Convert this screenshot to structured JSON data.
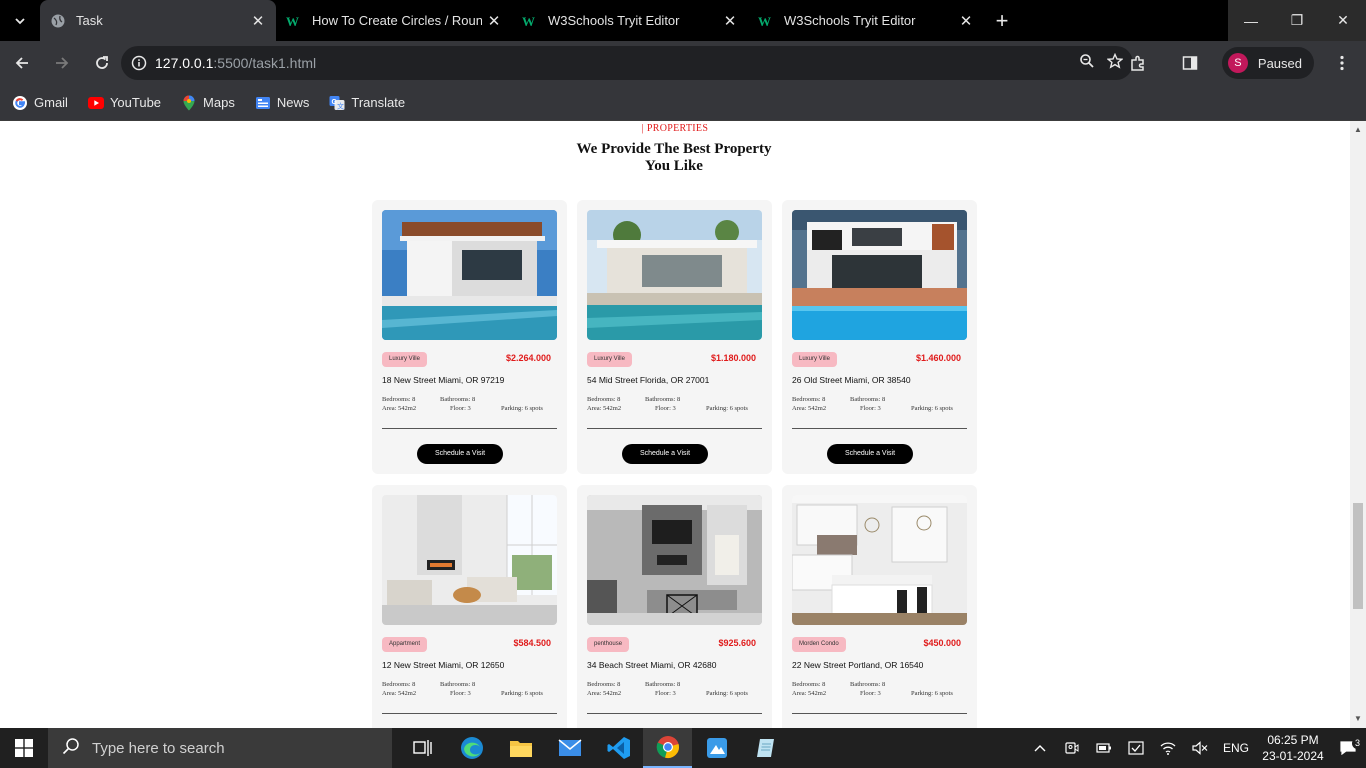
{
  "browser": {
    "tabs": [
      {
        "title": "Task",
        "active": true
      },
      {
        "title": "How To Create Circles / Round D",
        "active": false
      },
      {
        "title": "W3Schools Tryit Editor",
        "active": false
      },
      {
        "title": "W3Schools Tryit Editor",
        "active": false
      }
    ],
    "url_host": "127.0.0.1",
    "url_path": ":5500/task1.html",
    "profile_initial": "S",
    "profile_status": "Paused",
    "bookmarks": [
      "Gmail",
      "YouTube",
      "Maps",
      "News",
      "Translate"
    ]
  },
  "page": {
    "eyebrow": "| PROPERTIES",
    "heading": "We Provide The Best Property You Like",
    "schedule_label": "Schedule a Visit",
    "spec_labels": {
      "bedrooms": "Bedrooms: 8",
      "bathrooms": "Bathrooms: 8",
      "area": "Area: 542m2",
      "floor": "Floor: 3",
      "parking": "Parking: 6 spots"
    },
    "properties": [
      {
        "badge": "Luxury Ville",
        "price": "$2.264.000",
        "address": "18 New Street Miami, OR 97219"
      },
      {
        "badge": "Luxury Ville",
        "price": "$1.180.000",
        "address": "54 Mid Street Florida, OR 27001"
      },
      {
        "badge": "Luxury Ville",
        "price": "$1.460.000",
        "address": "26 Old Street Miami, OR 38540"
      },
      {
        "badge": "Appartment",
        "price": "$584.500",
        "address": "12 New Street Miami, OR 12650"
      },
      {
        "badge": "penthouse",
        "price": "$925.600",
        "address": "34 Beach Street Miami, OR 42680"
      },
      {
        "badge": "Morden Condo",
        "price": "$450.000",
        "address": "22 New Street Portland, OR 16540"
      }
    ]
  },
  "taskbar": {
    "search_placeholder": "Type here to search",
    "language": "ENG",
    "time": "06:25 PM",
    "date": "23-01-2024",
    "notifications": "3"
  }
}
